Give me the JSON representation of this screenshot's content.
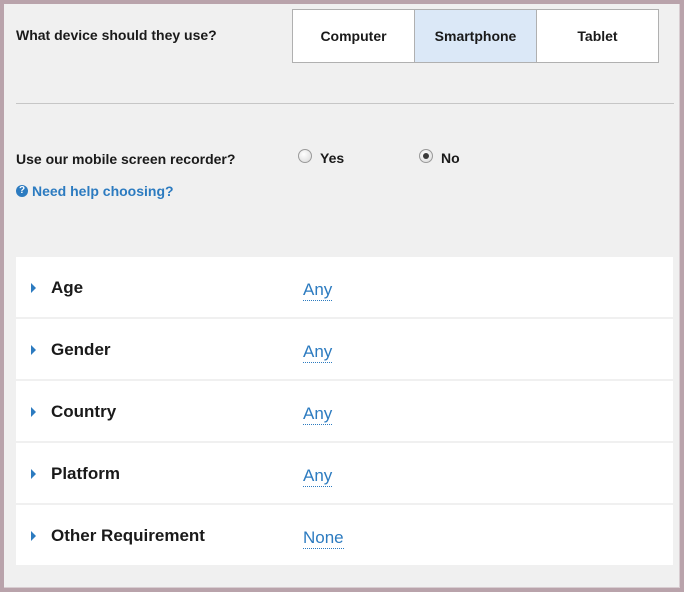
{
  "device": {
    "question": "What device should they use?",
    "options": [
      {
        "label": "Computer",
        "selected": false
      },
      {
        "label": "Smartphone",
        "selected": true
      },
      {
        "label": "Tablet",
        "selected": false
      }
    ]
  },
  "recorder": {
    "question": "Use our mobile screen recorder?",
    "options": [
      {
        "label": "Yes",
        "checked": false
      },
      {
        "label": "No",
        "checked": true
      }
    ],
    "help_link": "Need help choosing?",
    "help_icon": "question-circle-icon"
  },
  "filters": [
    {
      "label": "Age",
      "value": "Any"
    },
    {
      "label": "Gender",
      "value": "Any"
    },
    {
      "label": "Country",
      "value": "Any"
    },
    {
      "label": "Platform",
      "value": "Any"
    },
    {
      "label": "Other Requirement",
      "value": "None"
    }
  ],
  "colors": {
    "accent": "#2c7bc0",
    "selected_bg": "#dbe8f7",
    "panel_bg": "#f0f0f0",
    "frame": "#b9a3ab"
  }
}
